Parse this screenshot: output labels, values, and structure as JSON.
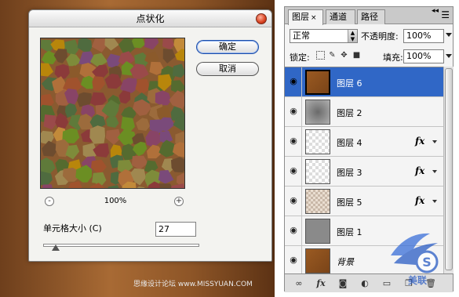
{
  "filter_dialog": {
    "title": "点状化",
    "ok_label": "确定",
    "cancel_label": "取消",
    "zoom_out": "-",
    "zoom_in": "+",
    "zoom_level": "100%",
    "cell_size_label": "单元格大小 (C)",
    "cell_size_value": "27",
    "slider_value": 27
  },
  "layers_panel": {
    "tabs": [
      {
        "label": "图层"
      },
      {
        "label": "通道"
      },
      {
        "label": "路径"
      }
    ],
    "tab_close": "×",
    "blend_mode": "正常",
    "opacity_label": "不透明度:",
    "opacity_value": "100%",
    "lock_label": "锁定:",
    "fill_label": "填充:",
    "fill_value": "100%",
    "layers": [
      {
        "name": "图层 6",
        "selected": true,
        "fx": false,
        "thumb": "brown"
      },
      {
        "name": "图层 2",
        "selected": false,
        "fx": false,
        "thumb": "gray-blur"
      },
      {
        "name": "图层 4",
        "selected": false,
        "fx": true,
        "thumb": "checker"
      },
      {
        "name": "图层 3",
        "selected": false,
        "fx": true,
        "thumb": "checker"
      },
      {
        "name": "图层 5",
        "selected": false,
        "fx": true,
        "thumb": "pattern"
      },
      {
        "name": "图层 1",
        "selected": false,
        "fx": false,
        "thumb": "gray"
      },
      {
        "name": "背景",
        "selected": false,
        "fx": false,
        "thumb": "brown"
      }
    ],
    "fx_label": "fx"
  },
  "watermark": "思缘设计论坛 www.MISSYUAN.COM",
  "colors": {
    "selected_row": "#3067c6",
    "background_brown": "#8a5428"
  }
}
